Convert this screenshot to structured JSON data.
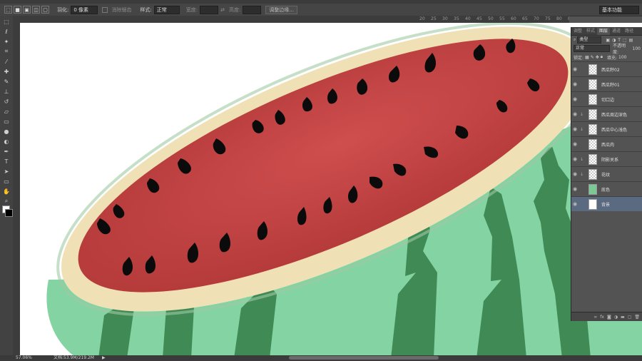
{
  "options_bar": {
    "feather_label": "羽化:",
    "feather_value": "0 像素",
    "antialias_label": "消除锯齿",
    "style_label": "样式:",
    "style_value": "正常",
    "width_label": "宽度:",
    "height_label": "高度:",
    "refine_edge": "调整边缘...",
    "workspace": "基本功能"
  },
  "ruler_top": [
    "20",
    "25",
    "30",
    "35",
    "40",
    "45",
    "50",
    "55",
    "60",
    "65",
    "70",
    "75",
    "80",
    "85"
  ],
  "layers_panel": {
    "tabs": [
      "调整",
      "样式",
      "图层",
      "通道",
      "路径"
    ],
    "filter_kind": "类型",
    "blend_mode": "正常",
    "opacity_label": "不透明度:",
    "opacity_value": "100",
    "lock_label": "锁定:",
    "fill_label": "填充:",
    "fill_value": "100",
    "layers": [
      {
        "name": "西瓜籽02",
        "thumb": "checker",
        "clipped": false,
        "selected": false
      },
      {
        "name": "西瓜籽01",
        "thumb": "checker",
        "clipped": false,
        "selected": false
      },
      {
        "name": "切口边",
        "thumb": "checker",
        "clipped": false,
        "selected": false
      },
      {
        "name": "西瓜周边深色",
        "thumb": "checker",
        "clipped": true,
        "selected": false
      },
      {
        "name": "西瓜中心浅色",
        "thumb": "checker",
        "clipped": true,
        "selected": false
      },
      {
        "name": "西瓜肉",
        "thumb": "checker",
        "clipped": false,
        "selected": false
      },
      {
        "name": "阴影关系",
        "thumb": "checker",
        "clipped": true,
        "selected": false
      },
      {
        "name": "花纹",
        "thumb": "checker",
        "clipped": true,
        "selected": false
      },
      {
        "name": "底色",
        "thumb": "green",
        "clipped": false,
        "selected": false
      },
      {
        "name": "背景",
        "thumb": "white",
        "clipped": false,
        "selected": true
      }
    ]
  },
  "status": {
    "zoom": "57.06%",
    "doc_size": "文档:53.9M/219.2M"
  }
}
